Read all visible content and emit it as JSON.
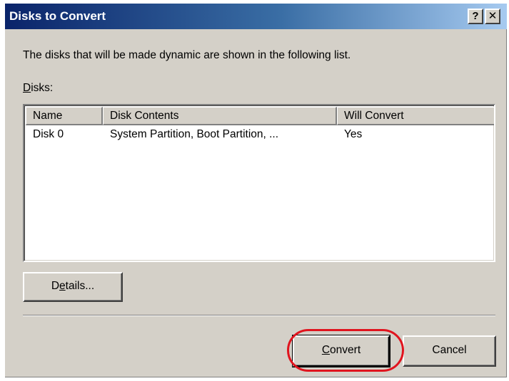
{
  "window": {
    "title": "Disks to Convert",
    "help_glyph": "?",
    "close_glyph": "✕"
  },
  "intro_text": "The disks that will be made dynamic are shown in the following list.",
  "disks_label": {
    "mnemonic": "D",
    "rest": "isks:"
  },
  "table": {
    "columns": [
      "Name",
      "Disk Contents",
      "Will Convert"
    ],
    "rows": [
      [
        "Disk 0",
        "System Partition, Boot Partition, ...",
        "Yes"
      ]
    ]
  },
  "buttons": {
    "details": {
      "before": "D",
      "mnemonic": "e",
      "after": "tails..."
    },
    "convert": {
      "mnemonic": "C",
      "after": "onvert"
    },
    "cancel": "Cancel"
  },
  "colors": {
    "title_gradient_start": "#0a246a",
    "title_gradient_end": "#a6caf0",
    "dialog_face": "#d4d0c8",
    "highlight": "#e0141e"
  }
}
